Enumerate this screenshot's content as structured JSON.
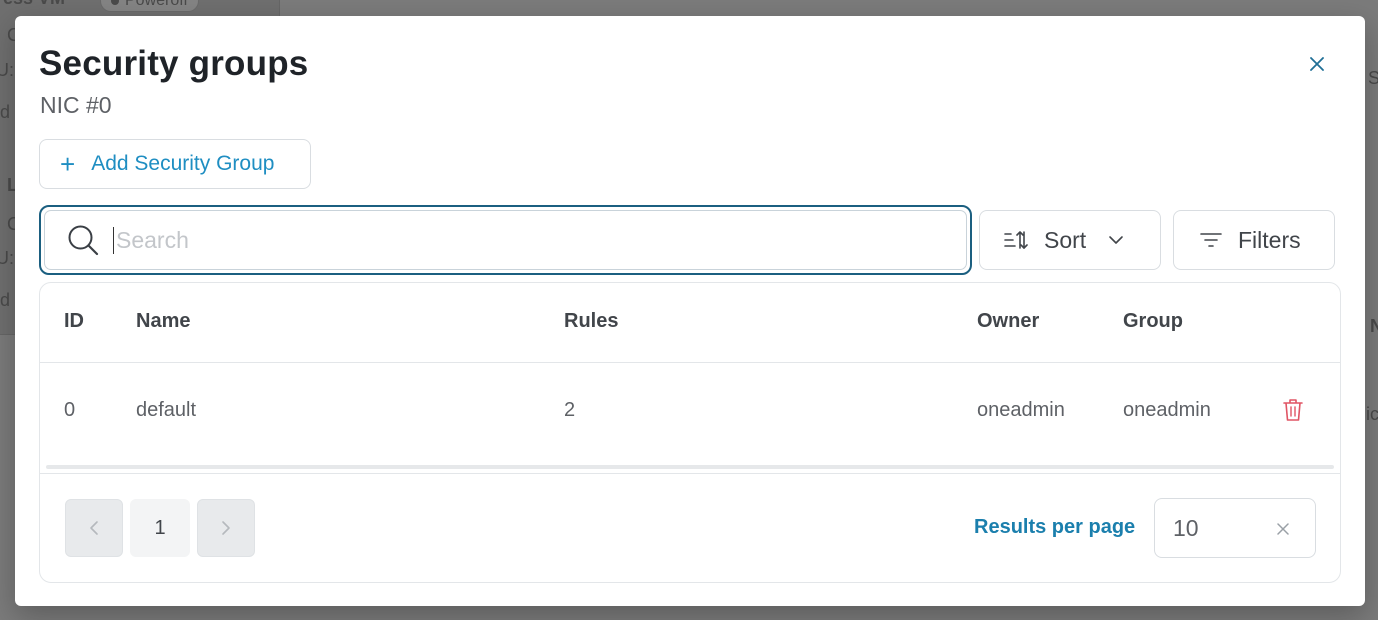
{
  "background": {
    "vm_title_fragment": "ress VM",
    "vm_status": "Poweroff",
    "frag_1": "C",
    "frag_2": "U:",
    "frag_3": "d",
    "frag_4": "L",
    "frag_5": "C",
    "frag_6": "U:",
    "frag_7": "d",
    "frag_8": "S",
    "frag_9": "N",
    "frag_10": "ic"
  },
  "dialog": {
    "title": "Security groups",
    "subtitle": "NIC #0",
    "close_icon": "close-icon",
    "add_button_label": "Add Security Group"
  },
  "search": {
    "placeholder": "Search",
    "value": ""
  },
  "toolbar": {
    "sort_label": "Sort",
    "filters_label": "Filters"
  },
  "table": {
    "columns": [
      "ID",
      "Name",
      "Rules",
      "Owner",
      "Group"
    ],
    "rows": [
      {
        "id": "0",
        "name": "default",
        "rules": "2",
        "owner": "oneadmin",
        "group": "oneadmin"
      }
    ]
  },
  "pagination": {
    "current_page": "1",
    "results_per_page_label": "Results per page",
    "results_per_page_value": "10"
  },
  "colors": {
    "accent": "#1f8ec2",
    "focus_border": "#1b5f80",
    "danger": "#e05565"
  }
}
